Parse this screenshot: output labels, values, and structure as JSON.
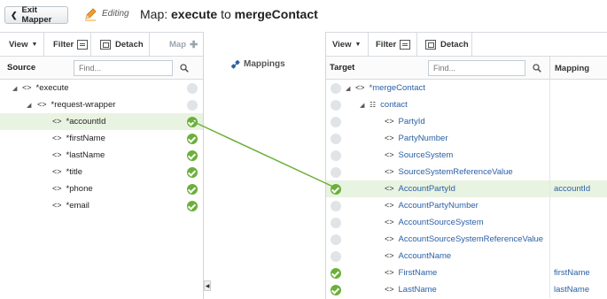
{
  "header": {
    "exit_label": "Exit Mapper",
    "editing_label": "Editing",
    "title_prefix": "Map:",
    "title_source": "execute",
    "title_mid": "to",
    "title_target": "mergeContact"
  },
  "source_panel": {
    "toolbar": {
      "view": "View",
      "filter": "Filter",
      "detach": "Detach",
      "map": "Map"
    },
    "header_label": "Source",
    "find_placeholder": "Find...",
    "rows": [
      {
        "label": "*execute",
        "status": "empty"
      },
      {
        "label": "*request-wrapper",
        "status": "empty"
      },
      {
        "label": "*accountId",
        "status": "ok"
      },
      {
        "label": "*firstName",
        "status": "ok"
      },
      {
        "label": "*lastName",
        "status": "ok"
      },
      {
        "label": "*title",
        "status": "ok"
      },
      {
        "label": "*phone",
        "status": "ok"
      },
      {
        "label": "*email",
        "status": "ok"
      }
    ]
  },
  "middle": {
    "mappings_label": "Mappings"
  },
  "target_panel": {
    "toolbar": {
      "view": "View",
      "filter": "Filter",
      "detach": "Detach"
    },
    "header_label": "Target",
    "find_placeholder": "Find...",
    "mapping_col": "Mapping",
    "rows": [
      {
        "label": "*mergeContact",
        "status": "empty",
        "mapping": ""
      },
      {
        "label": "contact",
        "status": "empty",
        "mapping": ""
      },
      {
        "label": "PartyId",
        "status": "empty",
        "mapping": ""
      },
      {
        "label": "PartyNumber",
        "status": "empty",
        "mapping": ""
      },
      {
        "label": "SourceSystem",
        "status": "empty",
        "mapping": ""
      },
      {
        "label": "SourceSystemReferenceValue",
        "status": "empty",
        "mapping": ""
      },
      {
        "label": "AccountPartyId",
        "status": "ok",
        "mapping": "accountId"
      },
      {
        "label": "AccountPartyNumber",
        "status": "empty",
        "mapping": ""
      },
      {
        "label": "AccountSourceSystem",
        "status": "empty",
        "mapping": ""
      },
      {
        "label": "AccountSourceSystemReferenceValue",
        "status": "empty",
        "mapping": ""
      },
      {
        "label": "AccountName",
        "status": "empty",
        "mapping": ""
      },
      {
        "label": "FirstName",
        "status": "ok",
        "mapping": "firstName"
      },
      {
        "label": "LastName",
        "status": "ok",
        "mapping": "lastName"
      }
    ]
  },
  "colors": {
    "ok": "#6ab03a",
    "link": "#6ab03a",
    "selected_row": "#e9f3e2",
    "target_text": "#2a5fa5"
  }
}
